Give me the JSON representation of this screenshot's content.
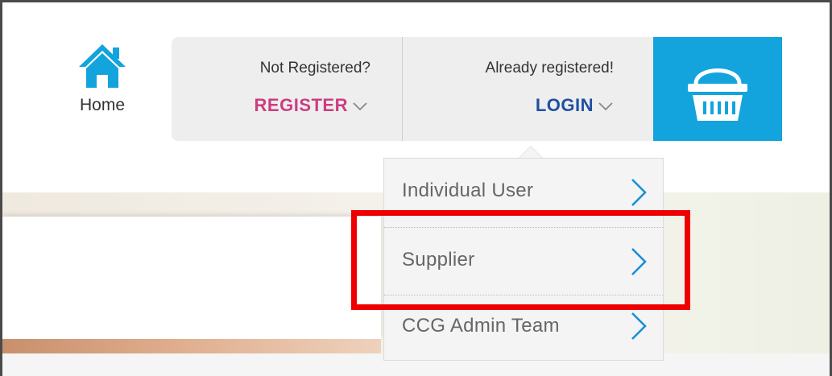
{
  "home": {
    "label": "Home",
    "icon": "home-icon"
  },
  "register": {
    "hint": "Not Registered?",
    "action": "REGISTER",
    "icon": "chevron-down-icon",
    "color": "#cc3d82"
  },
  "login": {
    "hint": "Already registered!",
    "action": "LOGIN",
    "icon": "chevron-down-icon",
    "color": "#1f4fa3"
  },
  "basket": {
    "icon": "basket-icon",
    "color": "#13a4dd"
  },
  "login_menu": {
    "items": [
      {
        "label": "Individual User",
        "icon": "chevron-right-icon"
      },
      {
        "label": "Supplier",
        "icon": "chevron-right-icon"
      },
      {
        "label": "CCG Admin Team",
        "icon": "chevron-right-icon"
      }
    ]
  },
  "highlight": {
    "color": "#ee0000",
    "target": "Supplier"
  }
}
